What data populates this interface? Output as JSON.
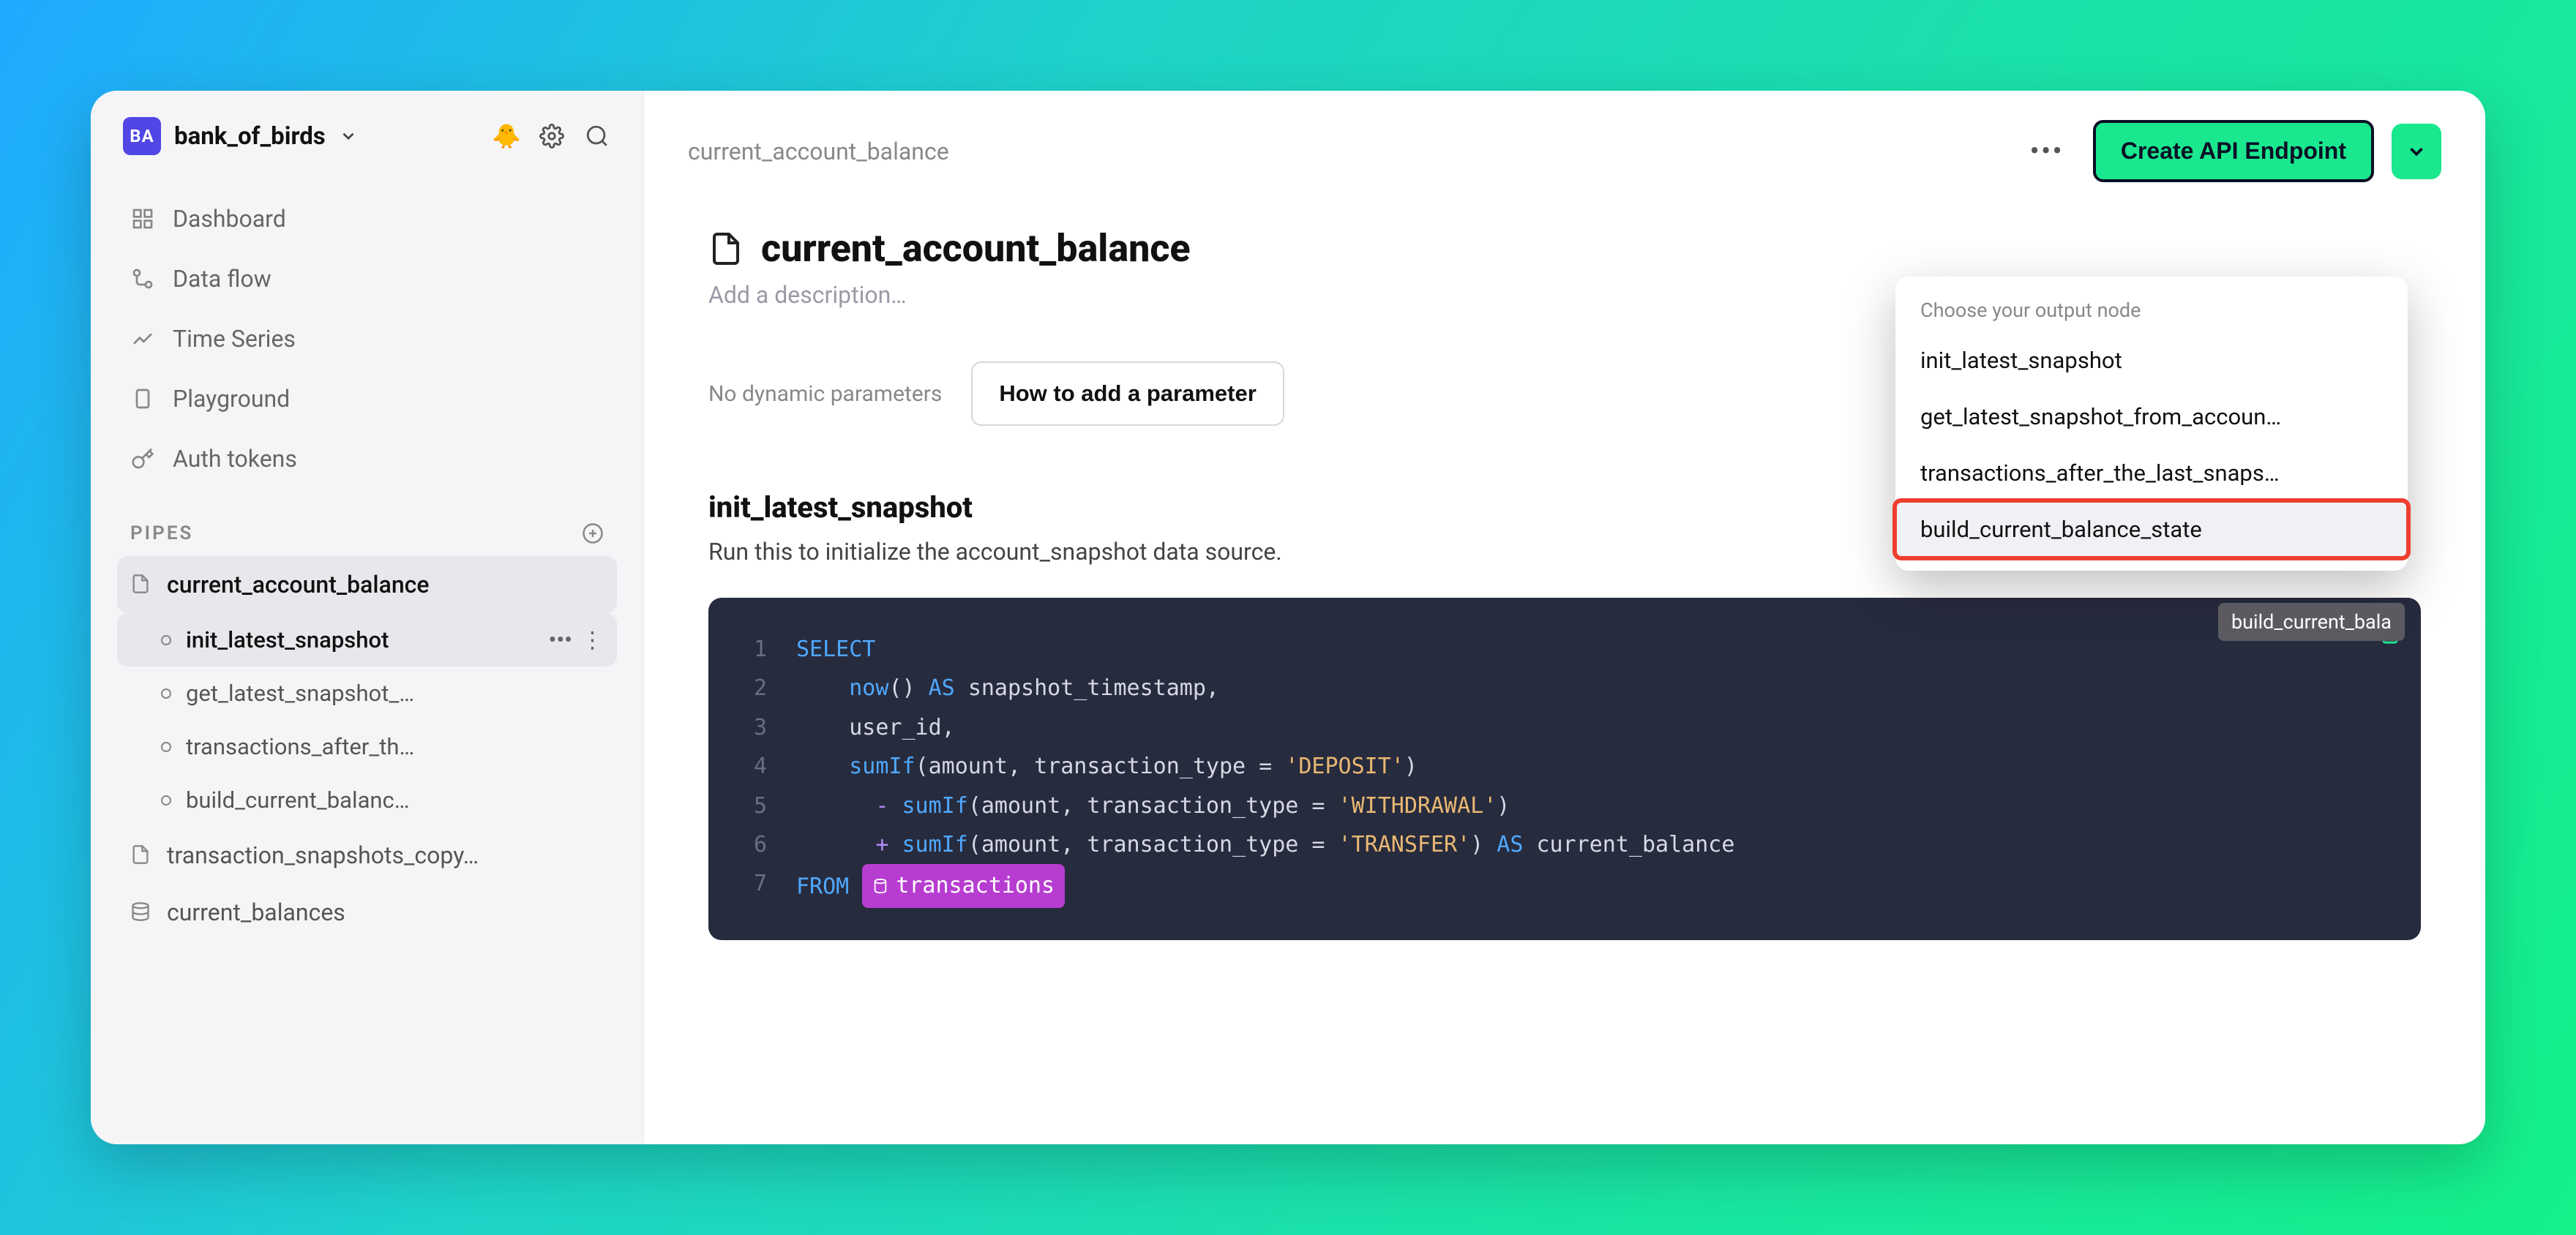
{
  "workspace": {
    "badge": "BA",
    "name": "bank_of_birds"
  },
  "sidebar": {
    "nav": [
      {
        "label": "Dashboard"
      },
      {
        "label": "Data flow"
      },
      {
        "label": "Time Series"
      },
      {
        "label": "Playground"
      },
      {
        "label": "Auth tokens"
      }
    ],
    "section_label": "PIPES",
    "pipes": [
      {
        "label": "current_account_balance",
        "active": true,
        "nodes": [
          {
            "label": "init_latest_snapshot",
            "active": true
          },
          {
            "label": "get_latest_snapshot_…"
          },
          {
            "label": "transactions_after_th…"
          },
          {
            "label": "build_current_balanc…"
          }
        ]
      },
      {
        "label": "transaction_snapshots_copy…"
      },
      {
        "label": "current_balances"
      }
    ]
  },
  "header": {
    "breadcrumb": "current_account_balance",
    "cta": "Create API Endpoint"
  },
  "page": {
    "title": "current_account_balance",
    "description_placeholder": "Add a description…",
    "params_text": "No dynamic parameters",
    "param_button": "How to add a parameter"
  },
  "node": {
    "title": "init_latest_snapshot",
    "description": "Run this to initialize the account_snapshot data source.",
    "code": {
      "lines": [
        "1",
        "2",
        "3",
        "4",
        "5",
        "6",
        "7"
      ],
      "l1_kw": "SELECT",
      "l2_fn": "now",
      "l2_as": "AS",
      "l2_id": "snapshot_timestamp,",
      "l3": "user_id,",
      "l4_fn": "sumIf",
      "l4_args": "(amount, transaction_type = ",
      "l4_str": "'DEPOSIT'",
      "l4_close": ")",
      "l5_op": "-",
      "l5_fn": "sumIf",
      "l5_args": "(amount, transaction_type = ",
      "l5_str": "'WITHDRAWAL'",
      "l5_close": ")",
      "l6_op": "+",
      "l6_fn": "sumIf",
      "l6_args": "(amount, transaction_type = ",
      "l6_str": "'TRANSFER'",
      "l6_close": ") ",
      "l6_as": "AS",
      "l6_id": " current_balance",
      "l7_kw": "FROM",
      "l7_tag": "transactions"
    }
  },
  "popover": {
    "header": "Choose your output node",
    "items": [
      "init_latest_snapshot",
      "get_latest_snapshot_from_accoun…",
      "transactions_after_the_last_snaps…",
      "build_current_balance_state"
    ],
    "tooltip": "build_current_bala"
  }
}
